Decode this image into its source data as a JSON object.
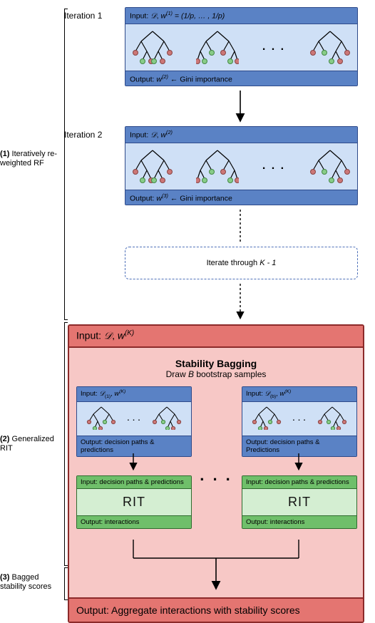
{
  "side": {
    "one_num": "(1)",
    "one": "Iteratively re-weighted RF",
    "two_num": "(2)",
    "two": "Generalized RIT",
    "three_num": "(3)",
    "three": "Bagged stability scores"
  },
  "iter": {
    "it1_title": "Iteration 1",
    "it2_title": "Iteration 2",
    "it1_input_pref": "Input: ",
    "it1_input_w_html": "𝒟, w⁽¹⁾ = (1/p, … , 1/p)",
    "it1_input_D": "𝒟",
    "it1_input_sep": ", ",
    "it1_input_w": "w",
    "it1_input_sup1": "(1)",
    "it1_input_rest": " = (1/p, … , 1/p)",
    "it2_input_sup": "(2)",
    "out_prefix": "Output: ",
    "out_w": "w",
    "out_sup2": "(2)",
    "out_sup3": "(3)",
    "out_arrow": " ← ",
    "out_gini": "Gini importance",
    "iterate_box": "Iterate through ",
    "iterate_K": "K - 1"
  },
  "stab": {
    "head_prefix": "Input: ",
    "head_D": "𝒟",
    "head_sep": ", ",
    "head_w": "w",
    "head_wK": "(K)",
    "title": "Stability Bagging",
    "sub_prefix": "Draw ",
    "sub_B": "B",
    "sub_suffix": " bootstrap samples",
    "sb1_input_D": "𝒟",
    "sb1_input_Dsub": "(1)",
    "sb_w": "w",
    "sb_wK": "(K)",
    "sb_b_input_Dsub": "(b)",
    "sb_out": "Output: decision paths & predictions",
    "sb_outB": "Output: decision paths & Predictions",
    "rit_in": "Input: decision paths & predictions",
    "rit_label": "RIT",
    "rit_out": "Output: interactions",
    "foot": "Output: Aggregate interactions with stability scores"
  },
  "ellipsis": ". . ."
}
